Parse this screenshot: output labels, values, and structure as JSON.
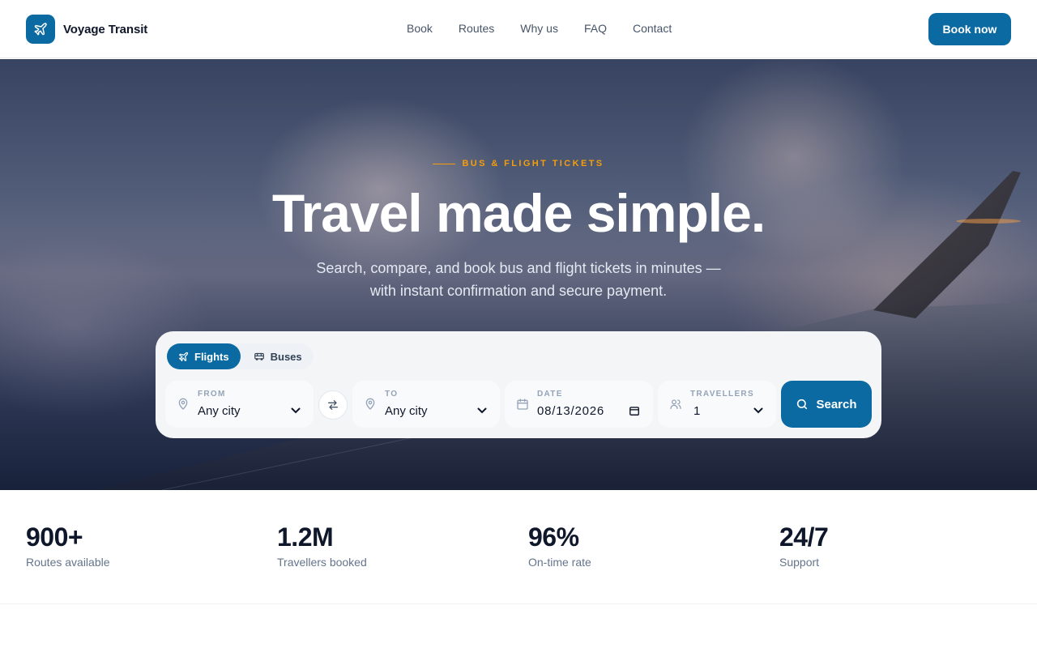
{
  "brand": {
    "name": "Voyage Transit",
    "icon": "plane-icon"
  },
  "nav": [
    "Book",
    "Routes",
    "Why us",
    "FAQ",
    "Contact"
  ],
  "header": {
    "cta_label": "Book now"
  },
  "hero": {
    "eyebrow": "BUS & FLIGHT TICKETS",
    "title": "Travel made simple.",
    "subtitle_line1": "Search, compare, and book bus and flight tickets in minutes —",
    "subtitle_line2": "with instant confirmation and secure payment."
  },
  "search": {
    "tabs": [
      {
        "label": "Flights",
        "icon": "plane-icon",
        "active": true
      },
      {
        "label": "Buses",
        "icon": "bus-icon",
        "active": false
      }
    ],
    "from": {
      "label": "FROM",
      "value": "Any city",
      "icon": "map-pin-icon"
    },
    "to": {
      "label": "TO",
      "value": "Any city",
      "icon": "map-pin-icon"
    },
    "date": {
      "label": "DATE",
      "value": "08/13/2026",
      "icon": "calendar-icon"
    },
    "travellers": {
      "label": "TRAVELLERS",
      "value": "1",
      "icon": "users-icon"
    },
    "button_label": "Search"
  },
  "stats": [
    {
      "value": "900+",
      "label": "Routes available"
    },
    {
      "value": "1.2M",
      "label": "Travellers booked"
    },
    {
      "value": "96%",
      "label": "On-time rate"
    },
    {
      "value": "24/7",
      "label": "Support"
    }
  ],
  "colors": {
    "primary": "#0b6aa2",
    "accent": "#f59e0b",
    "text": "#0f172a",
    "muted": "#64748b"
  }
}
